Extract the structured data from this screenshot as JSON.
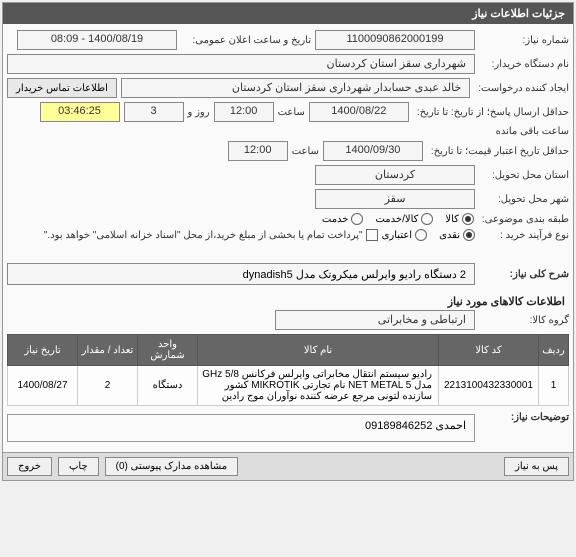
{
  "header": {
    "title": "جزئیات اطلاعات نیاز"
  },
  "fields": {
    "need_number_label": "شماره نیاز:",
    "need_number": "1100090862000199",
    "announce_label": "تاریخ و ساعت اعلان عمومی:",
    "announce_value": "1400/08/19 - 08:09",
    "buyer_label": "نام دستگاه خریدار:",
    "buyer_value": "شهرداری سقز استان کردستان",
    "requester_label": "ایجاد کننده درخواست:",
    "requester_value": "خالد عبدی حسابدار شهرداری سقز استان کردستان",
    "contact_btn": "اطلاعات تماس خریدار",
    "deadline_label": "حداقل ارسال پاسخ؛ از تاریخ: تا تاریخ:",
    "deadline_date": "1400/08/22",
    "time_label": "ساعت",
    "deadline_time": "12:00",
    "deadline_suffix": "روز و",
    "deadline_days": "3",
    "remaining_time": "03:46:25",
    "remaining_label": "ساعت باقی مانده",
    "validity_label": "حداقل تاریخ اعتبار قیمت؛ تا تاریخ:",
    "validity_date": "1400/09/30",
    "validity_time": "12:00",
    "province_label": "استان محل تحویل:",
    "province_value": "کردستان",
    "city_label": "شهر محل تحویل:",
    "city_value": "سقز",
    "category_label": "طبقه بندی موضوعی:",
    "cat_goods": "کالا",
    "cat_service": "کالا/خدمت",
    "cat_serv": "خدمت",
    "process_label": "نوع فرآیند خرید :",
    "proc_cash": "نقدی",
    "proc_credit": "اعتباری",
    "proc_note": "\"پرداخت تمام یا بخشی از مبلغ خرید،از محل \"اسناد خزانه اسلامی\" خواهد بود.\"",
    "desc_label": "شرح کلی نیاز:",
    "desc_value": "2 دستگاه رادیو وایرلس میکروتک مدل dynadish5",
    "items_title": "اطلاعات کالاهای مورد نیاز",
    "group_label": "گروه کالا:",
    "group_value": "ارتباطی و مخابراتی",
    "notes_label": "توضیحات نیاز:",
    "notes_value": "احمدی 09189846252"
  },
  "table": {
    "headers": {
      "row": "ردیف",
      "code": "کد کالا",
      "name": "نام کالا",
      "unit": "واحد شمارش",
      "qty": "تعداد / مقدار",
      "date": "تاریخ نیاز"
    },
    "rows": [
      {
        "idx": "1",
        "code": "2213100432330001",
        "name": "رادیو سیستم انتقال مخابراتی وایرلس فرکانس GHz 5/8 مدل NET METAL 5 نام تجارتی MIKROTIK کشور سازنده لتونی مرجع عرضه کننده نوآوران موج رادین",
        "unit": "دستگاه",
        "qty": "2",
        "date": "1400/08/27"
      }
    ]
  },
  "footer": {
    "back": "پس به نیاز",
    "attachments": "مشاهده مدارک پیوستی (0)",
    "print": "چاپ",
    "close": "خروج"
  }
}
